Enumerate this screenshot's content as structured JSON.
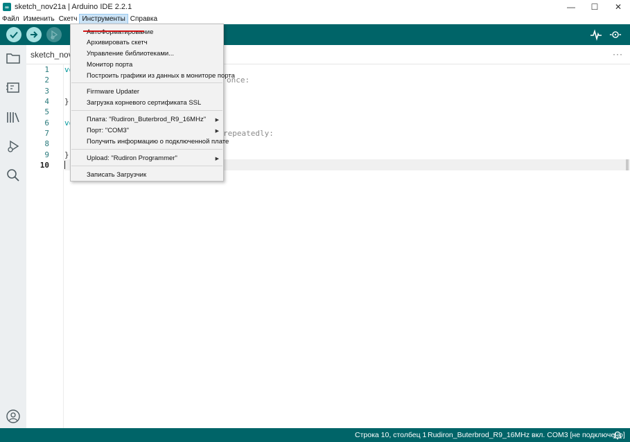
{
  "window": {
    "title": "sketch_nov21a | Arduino IDE 2.2.1",
    "app_icon": "arduino-logo",
    "controls": [
      "—",
      "☐",
      "✕"
    ]
  },
  "menubar": {
    "items": [
      "Файл",
      "Изменить",
      "Скетч",
      "Инструменты",
      "Справка"
    ],
    "active": "Инструменты"
  },
  "toolbar": {
    "verify_icon": "check-icon",
    "upload_icon": "arrow-right-icon",
    "debug_icon": "debug-icon",
    "serial_plotter_icon": "pulse-icon",
    "serial_monitor_icon": "serial-monitor-icon"
  },
  "sidebar": {
    "icons": [
      "folder-icon",
      "board-icon",
      "library-icon",
      "debug-icon",
      "search-icon",
      "account-icon"
    ]
  },
  "tabs": {
    "active": "sketch_nov2",
    "more": "···"
  },
  "editor": {
    "line_numbers": [
      "1",
      "2",
      "3",
      "4",
      "5",
      "6",
      "7",
      "8",
      "9",
      "10"
    ],
    "current_line": "10",
    "visible_code": {
      "l1": "vo",
      "l2_comment": "once:",
      "l4": "}",
      "l6": "vo",
      "l7_comment": "repeatedly:",
      "l9": "}"
    }
  },
  "tools_menu": {
    "groups": [
      [
        "АвтоФорматирование",
        "Архивировать скетч",
        "Управление библиотеками...",
        "Монитор порта",
        "Построить графики из данных в мониторе порта"
      ],
      [
        "Firmware Updater",
        "Загрузка корневого сертификата SSL"
      ],
      [
        "Плата: \"Rudiron_Buterbrod_R9_16MHz\"",
        "Порт: \"COM3\"",
        "Получить информацию о подключенной плате"
      ],
      [
        "Upload: \"Rudiron Programmer\""
      ],
      [
        "Записать Загрузчик"
      ]
    ],
    "submenu_arrow": "▶",
    "highlight_color": "#d01818"
  },
  "statusbar": {
    "position": "Строка 10, столбец 1",
    "board": "Rudiron_Buterbrod_R9_16MHz вкл. COM3 [не подключено]",
    "bell_icon": "bell-icon"
  },
  "colors": {
    "teal_dark": "#006468",
    "teal_light": "#a7e1e1",
    "sidebar_bg": "#eceff1"
  }
}
